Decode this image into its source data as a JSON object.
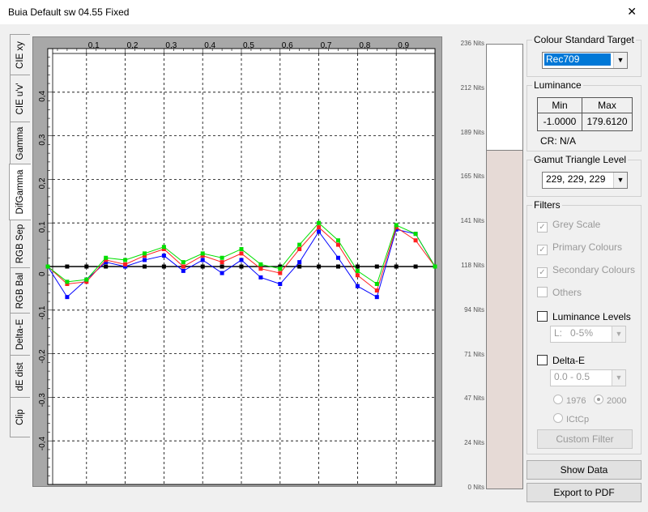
{
  "window": {
    "title": "Buia Default sw 04.55 Fixed",
    "close_glyph": "✕"
  },
  "tabs": [
    {
      "label": "CIE xy",
      "active": false
    },
    {
      "label": "CIE u'v'",
      "active": false
    },
    {
      "label": "Gamma",
      "active": false
    },
    {
      "label": "DifGamma",
      "active": true
    },
    {
      "label": "RGB Sep",
      "active": false
    },
    {
      "label": "RGB Bal",
      "active": false
    },
    {
      "label": "Delta-E",
      "active": false
    },
    {
      "label": "dE dist",
      "active": false
    },
    {
      "label": "Clip",
      "active": false
    }
  ],
  "chart_data": {
    "type": "line",
    "x_ticks": [
      "0,1",
      "0,2",
      "0,3",
      "0,4",
      "0,5",
      "0,6",
      "0,7",
      "0,8",
      "0,9"
    ],
    "y_ticks": [
      "0,4",
      "0,3",
      "0,2",
      "0,1",
      "0",
      "-0,1",
      "-0,2",
      "-0,3",
      "-0,4"
    ],
    "xlim": [
      0,
      1
    ],
    "ylim": [
      -0.5,
      0.5
    ],
    "grid": true,
    "x": [
      0,
      0.05,
      0.1,
      0.15,
      0.2,
      0.25,
      0.3,
      0.35,
      0.4,
      0.45,
      0.5,
      0.55,
      0.6,
      0.65,
      0.7,
      0.75,
      0.8,
      0.85,
      0.9,
      0.95,
      1.0
    ],
    "series": [
      {
        "color": "#00e000",
        "values": [
          0,
          -0.035,
          -0.03,
          0.02,
          0.015,
          0.03,
          0.045,
          0.01,
          0.03,
          0.02,
          0.04,
          0.005,
          -0.005,
          0.05,
          0.1,
          0.06,
          -0.01,
          -0.04,
          0.095,
          0.075,
          0
        ]
      },
      {
        "color": "#ff2020",
        "values": [
          0,
          -0.04,
          -0.035,
          0.015,
          0.005,
          0.025,
          0.04,
          0.0,
          0.025,
          0.01,
          0.03,
          -0.005,
          -0.015,
          0.04,
          0.09,
          0.05,
          -0.02,
          -0.055,
          0.09,
          0.06,
          0
        ]
      },
      {
        "color": "#0000ff",
        "values": [
          0,
          -0.07,
          -0.03,
          0.01,
          0.0,
          0.015,
          0.025,
          -0.01,
          0.015,
          -0.015,
          0.015,
          -0.025,
          -0.04,
          0.01,
          0.08,
          0.02,
          -0.045,
          -0.07,
          0.085,
          0.075,
          0
        ]
      },
      {
        "color": "#000000",
        "values": [
          0,
          0,
          0,
          0,
          0,
          0,
          0,
          0,
          0,
          0,
          0,
          0,
          0,
          0,
          0,
          0,
          0,
          0,
          0,
          0,
          0
        ]
      }
    ]
  },
  "nits": {
    "labels": [
      "236 Nits",
      "212 Nits",
      "189 Nits",
      "165 Nits",
      "141 Nits",
      "118 Nits",
      "94 Nits",
      "71 Nits",
      "47 Nits",
      "24 Nits",
      "0 Nits"
    ],
    "max": 236,
    "level": 179.612
  },
  "colour_target": {
    "legend": "Colour Standard Target",
    "value": "Rec709"
  },
  "luminance": {
    "legend": "Luminance",
    "min_label": "Min",
    "max_label": "Max",
    "min_value": "-1.0000",
    "max_value": "179.6120",
    "cr": "CR: N/A"
  },
  "gamut": {
    "legend": "Gamut Triangle Level",
    "value": "229, 229, 229"
  },
  "filters": {
    "legend": "Filters",
    "grey_scale": "Grey Scale",
    "primary": "Primary Colours",
    "secondary": "Secondary Colours",
    "others": "Others",
    "lum_levels": "Luminance Levels",
    "lum_select": "L:   0-5%",
    "delta_e": "Delta-E",
    "de_select": "0.0 - 0.5",
    "r1976": "1976",
    "r2000": "2000",
    "rictcp": "ICtCp",
    "custom": "Custom Filter"
  },
  "buttons": {
    "show_data": "Show Data",
    "export": "Export to PDF"
  }
}
